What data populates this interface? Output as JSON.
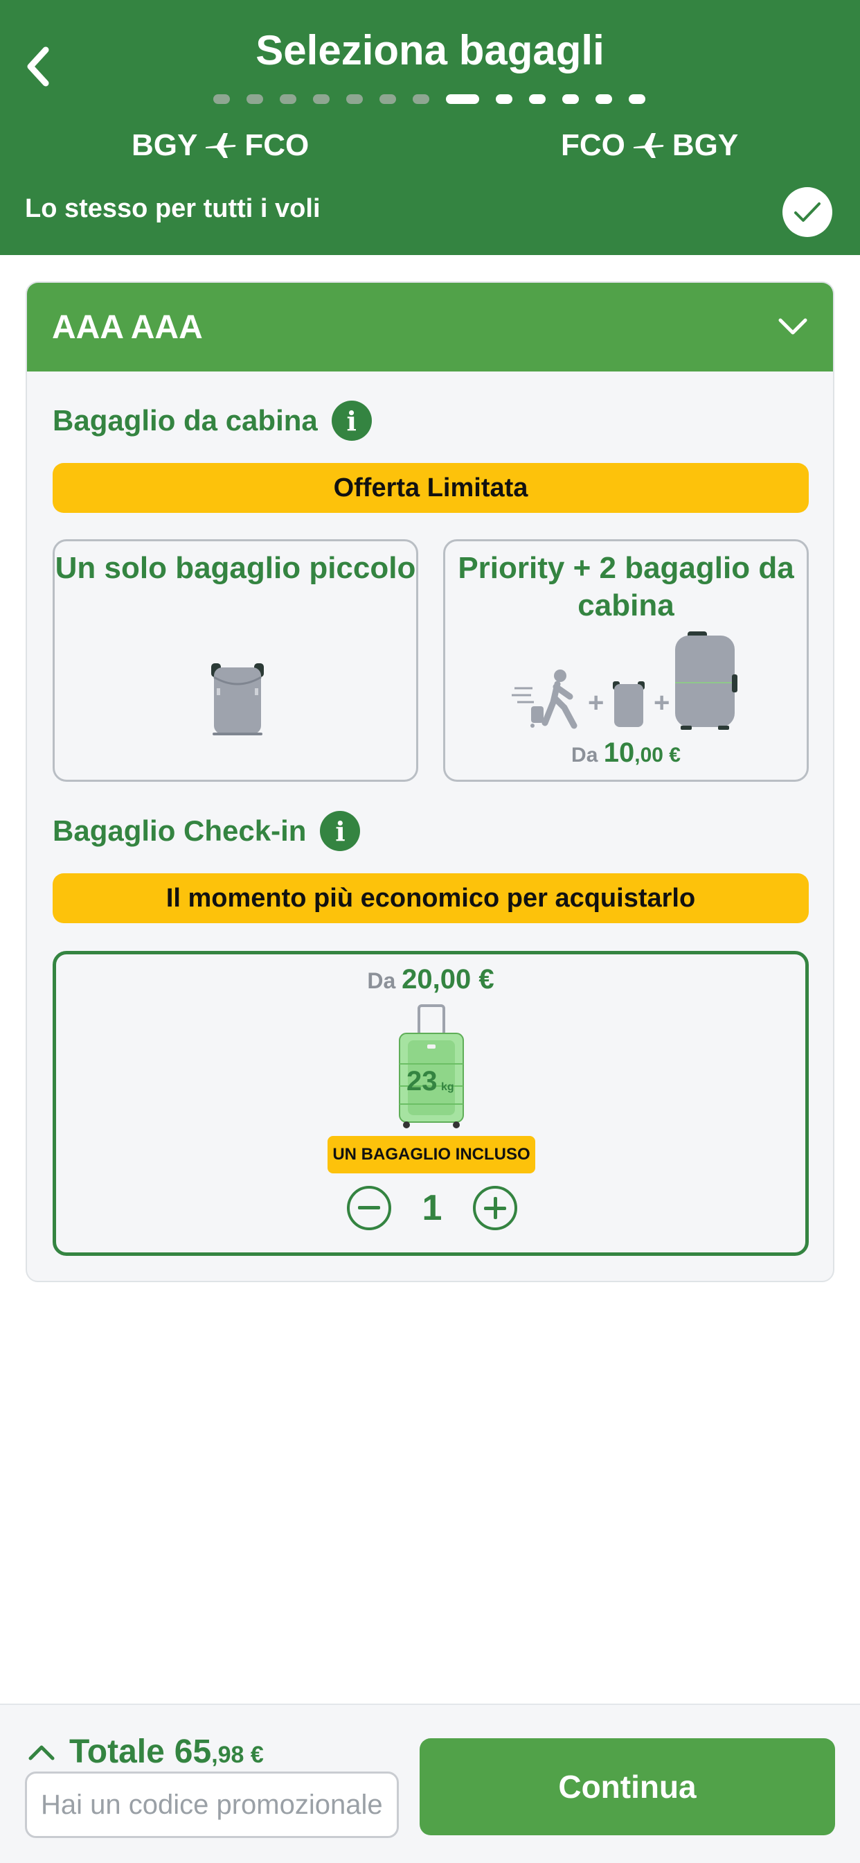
{
  "header": {
    "title": "Seleziona bagagli",
    "steps_total": 13,
    "steps_active": 8,
    "routes": [
      {
        "from": "BGY",
        "to": "FCO"
      },
      {
        "from": "FCO",
        "to": "BGY"
      }
    ],
    "same_for_all_label": "Lo stesso per tutti i voli",
    "same_for_all_checked": true
  },
  "passenger": {
    "name": "AAA AAA"
  },
  "cabin": {
    "title": "Bagaglio da cabina",
    "banner": "Offerta Limitata",
    "options": [
      {
        "title": "Un solo bagaglio piccolo",
        "icon": "small-backpack-icon"
      },
      {
        "title": "Priority + 2 bagaglio da cabina",
        "icon": "priority-bags-icon",
        "price_prefix": "Da",
        "price_int": "10",
        "price_dec": ",00 €"
      }
    ]
  },
  "checkin": {
    "title": "Bagaglio Check-in",
    "banner": "Il momento più economico per acquistarlo",
    "price_prefix": "Da",
    "price": "20,00 €",
    "weight": "23",
    "weight_unit": "kg",
    "included_badge": "UN BAGAGLIO INCLUSO",
    "quantity": "1"
  },
  "footer": {
    "total_label": "Totale",
    "total_int": "65",
    "total_dec": ",98 €",
    "promo_placeholder": "Hai un codice promozionale?",
    "continue_label": "Continua"
  },
  "colors": {
    "header_green": "#348441",
    "accent_green": "#51a249",
    "banner_yellow": "#fdc20b",
    "muted_gray": "#8c9199"
  }
}
